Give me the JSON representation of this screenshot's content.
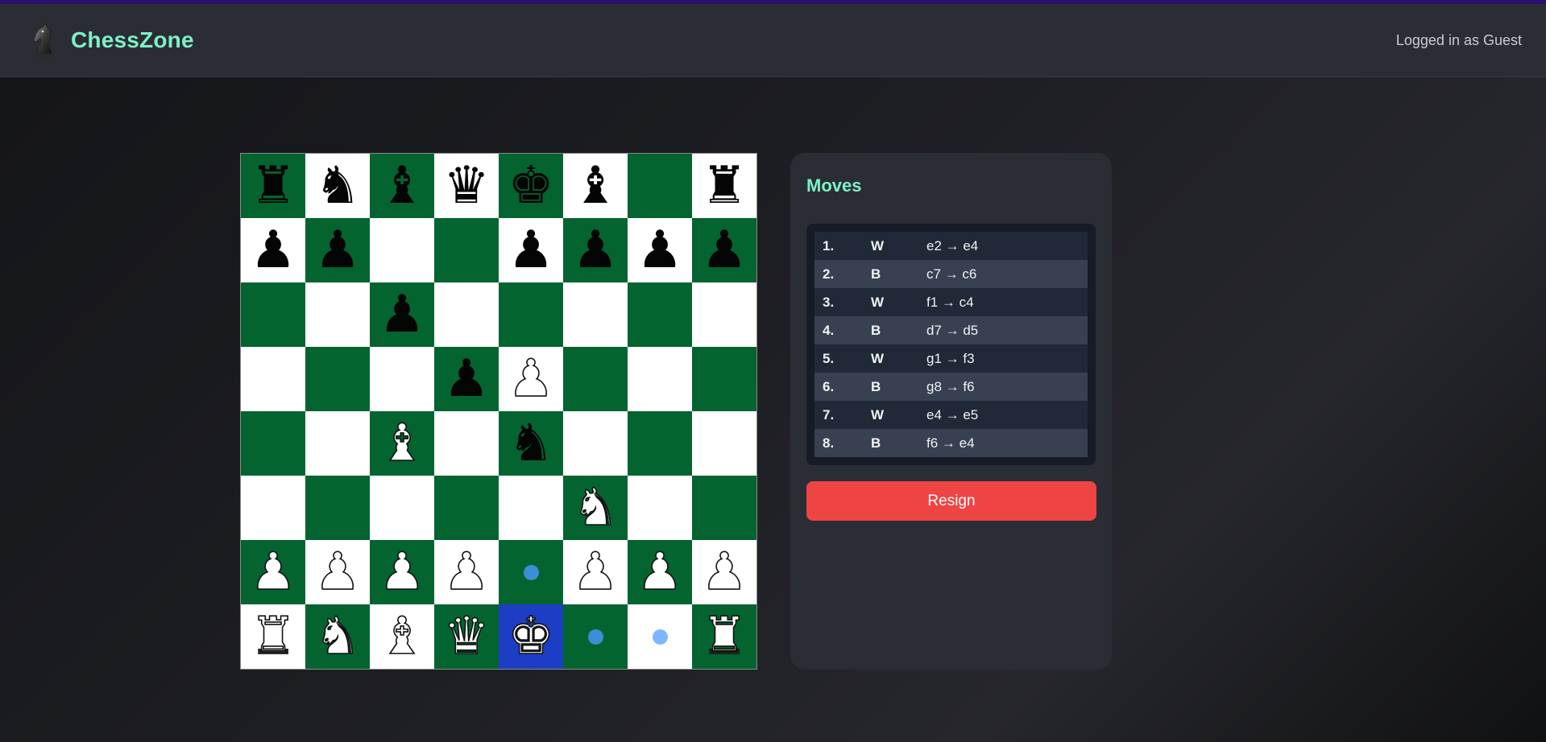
{
  "header": {
    "brand": "ChessZone",
    "user_status": "Logged in as Guest"
  },
  "board": {
    "rows": [
      [
        "bR",
        "bN",
        "bB",
        "bQ",
        "bK",
        "bB",
        "",
        "bR"
      ],
      [
        "bP",
        "bP",
        "",
        "",
        "bP",
        "bP",
        "bP",
        "bP"
      ],
      [
        "",
        "",
        "bP",
        "",
        "",
        "",
        "",
        ""
      ],
      [
        "",
        "",
        "",
        "bP",
        "wP",
        "",
        "",
        ""
      ],
      [
        "",
        "",
        "wB",
        "",
        "bN",
        "",
        "",
        ""
      ],
      [
        "",
        "",
        "",
        "",
        "",
        "wN",
        "",
        ""
      ],
      [
        "wP",
        "wP",
        "wP",
        "wP",
        "",
        "wP",
        "wP",
        "wP"
      ],
      [
        "wR",
        "wN",
        "wB",
        "wQ",
        "wK",
        "",
        "",
        "wR"
      ]
    ],
    "selected_square": "e1",
    "move_hints": [
      "e2",
      "f1",
      "g1"
    ]
  },
  "moves_panel": {
    "title": "Moves",
    "moves": [
      {
        "num": "1.",
        "side": "W",
        "text": "e2 → e4"
      },
      {
        "num": "2.",
        "side": "B",
        "text": "c7 → c6"
      },
      {
        "num": "3.",
        "side": "W",
        "text": "f1 → c4"
      },
      {
        "num": "4.",
        "side": "B",
        "text": "d7 → d5"
      },
      {
        "num": "5.",
        "side": "W",
        "text": "g1 → f3"
      },
      {
        "num": "6.",
        "side": "B",
        "text": "g8 → f6"
      },
      {
        "num": "7.",
        "side": "W",
        "text": "e4 → e5"
      },
      {
        "num": "8.",
        "side": "B",
        "text": "f6 → e4"
      }
    ],
    "resign_label": "Resign"
  },
  "colors": {
    "brand": "#7ff0c6",
    "dark_square": "#03642f",
    "light_square": "#ffffff",
    "selected_square": "#1c3ec4",
    "resign": "#ef4444"
  }
}
